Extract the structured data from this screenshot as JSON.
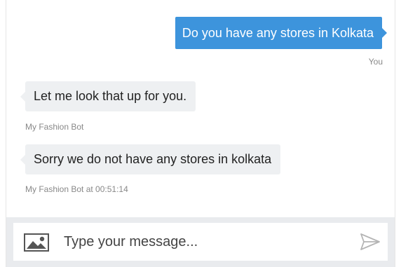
{
  "messages": [
    {
      "sender": "user",
      "text": "Do you have any stores in Kolkata",
      "meta": "You"
    },
    {
      "sender": "bot",
      "text": "Let me look that up for you.",
      "meta": "My Fashion Bot"
    },
    {
      "sender": "bot",
      "text": "Sorry we do not have any stores in kolkata",
      "meta": "My Fashion Bot at 00:51:14"
    }
  ],
  "composer": {
    "placeholder": "Type your message...",
    "attach_icon": "image-icon",
    "send_icon": "send-icon"
  },
  "colors": {
    "user_bubble": "#3d94dc",
    "bot_bubble": "#eef0f2",
    "composer_bar": "#e9ebee"
  }
}
